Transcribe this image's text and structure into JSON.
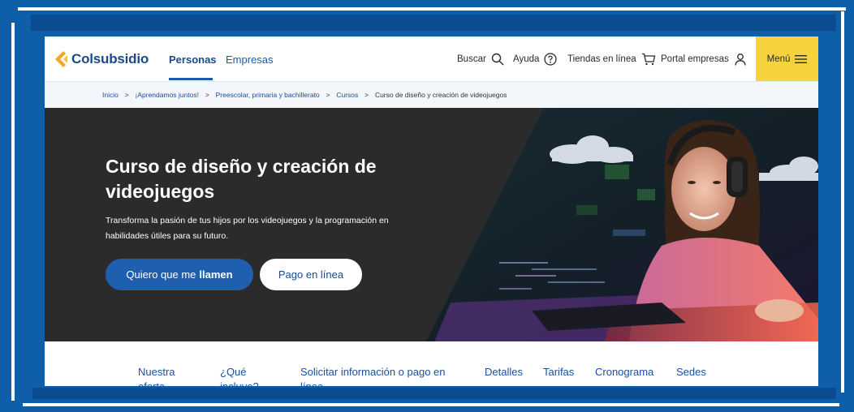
{
  "header": {
    "logo_text": "Colsubsidio",
    "nav": [
      "Personas",
      "Empresas"
    ],
    "utilities": {
      "search": "Buscar",
      "help": "Ayuda",
      "stores": "Tiendas en línea",
      "portal": "Portal empresas"
    },
    "menu_label": "Menú"
  },
  "breadcrumb": [
    "Inicio",
    "¡Aprendamos juntos!",
    "Preescolar, primaria y bachillerato",
    "Cursos",
    "Curso de diseño y creación de videojuegos"
  ],
  "hero": {
    "title": "Curso de diseño y creación de videojuegos",
    "description": "Transforma la pasión de tus hijos por los videojuegos y la programación en habilidades útiles para su futuro.",
    "primary_button": {
      "prefix": "Quiero que me",
      "bold": "llamen"
    },
    "secondary_button": "Pago en línea"
  },
  "section_tabs": [
    "Nuestra oferta",
    "¿Qué incluye?",
    "Solicitar información o pago en línea",
    "Detalles",
    "Tarifas",
    "Cronograma",
    "Sedes"
  ],
  "colors": {
    "frame_blue": "#0f5eaa",
    "brand_blue": "#1a4a8a",
    "button_blue": "#1f5fb0",
    "menu_yellow": "#f6d23c",
    "logo_orange": "#f5a623",
    "hero_dark": "#2b2b2b"
  },
  "icons": [
    "logo-chevron-icon",
    "search-icon",
    "help-icon",
    "cart-icon",
    "user-icon",
    "hamburger-icon",
    "chevron-right-icon"
  ]
}
